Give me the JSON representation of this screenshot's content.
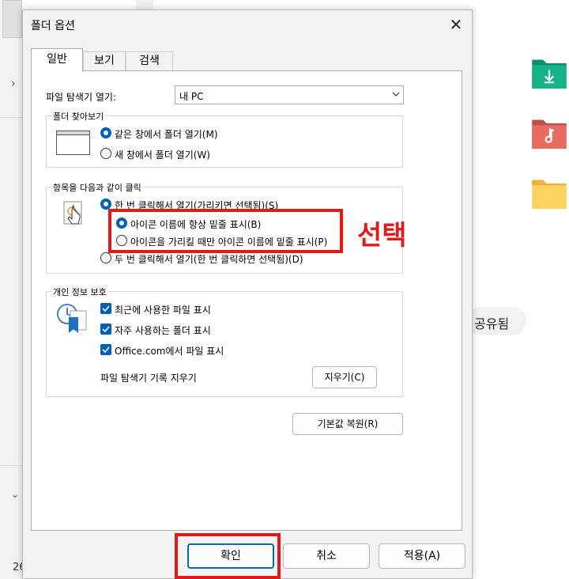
{
  "background": {
    "shared_label": "공유됨",
    "bottom_number": "26"
  },
  "dialog": {
    "title": "폴더 옵션",
    "tabs": [
      {
        "label": "일반",
        "active": true
      },
      {
        "label": "보기",
        "active": false
      },
      {
        "label": "검색",
        "active": false
      }
    ],
    "open_explorer_label": "파일 탐색기 열기:",
    "open_explorer_value": "내 PC",
    "browse_folders": {
      "title": "폴더 찾아보기",
      "options": [
        {
          "label": "같은 창에서 폴더 열기(M)",
          "checked": true
        },
        {
          "label": "새 창에서 폴더 열기(W)",
          "checked": false
        }
      ]
    },
    "click_items": {
      "title": "항목을 다음과 같이 클릭",
      "single_click": {
        "label": "한 번 클릭해서 열기(가리키면 선택됨)(S)",
        "checked": true
      },
      "sub_options": [
        {
          "label": "아이콘 이름에 항상 밑줄 표시(B)",
          "checked": true
        },
        {
          "label": "아이콘을 가리킬 때만 아이콘 이름에 밑줄 표시(P)",
          "checked": false
        }
      ],
      "double_click": {
        "label": "두 번 클릭해서 열기(한 번 클릭하면 선택됨)(D)",
        "checked": false
      }
    },
    "privacy": {
      "title": "개인 정보 보호",
      "checks": [
        {
          "label": "최근에 사용한 파일 표시",
          "checked": true
        },
        {
          "label": "자주 사용하는 폴더 표시",
          "checked": true
        },
        {
          "label": "Office.com에서 파일 표시",
          "checked": true
        }
      ],
      "clear_history_label": "파일 탐색기 기록 지우기",
      "clear_button": "지우기(C)"
    },
    "restore_defaults": "기본값 복원(R)",
    "buttons": {
      "ok": "확인",
      "cancel": "취소",
      "apply": "적용(A)"
    }
  },
  "annotation": {
    "text": "선택",
    "color": "#e0191b"
  },
  "colors": {
    "accent": "#005fb8"
  }
}
